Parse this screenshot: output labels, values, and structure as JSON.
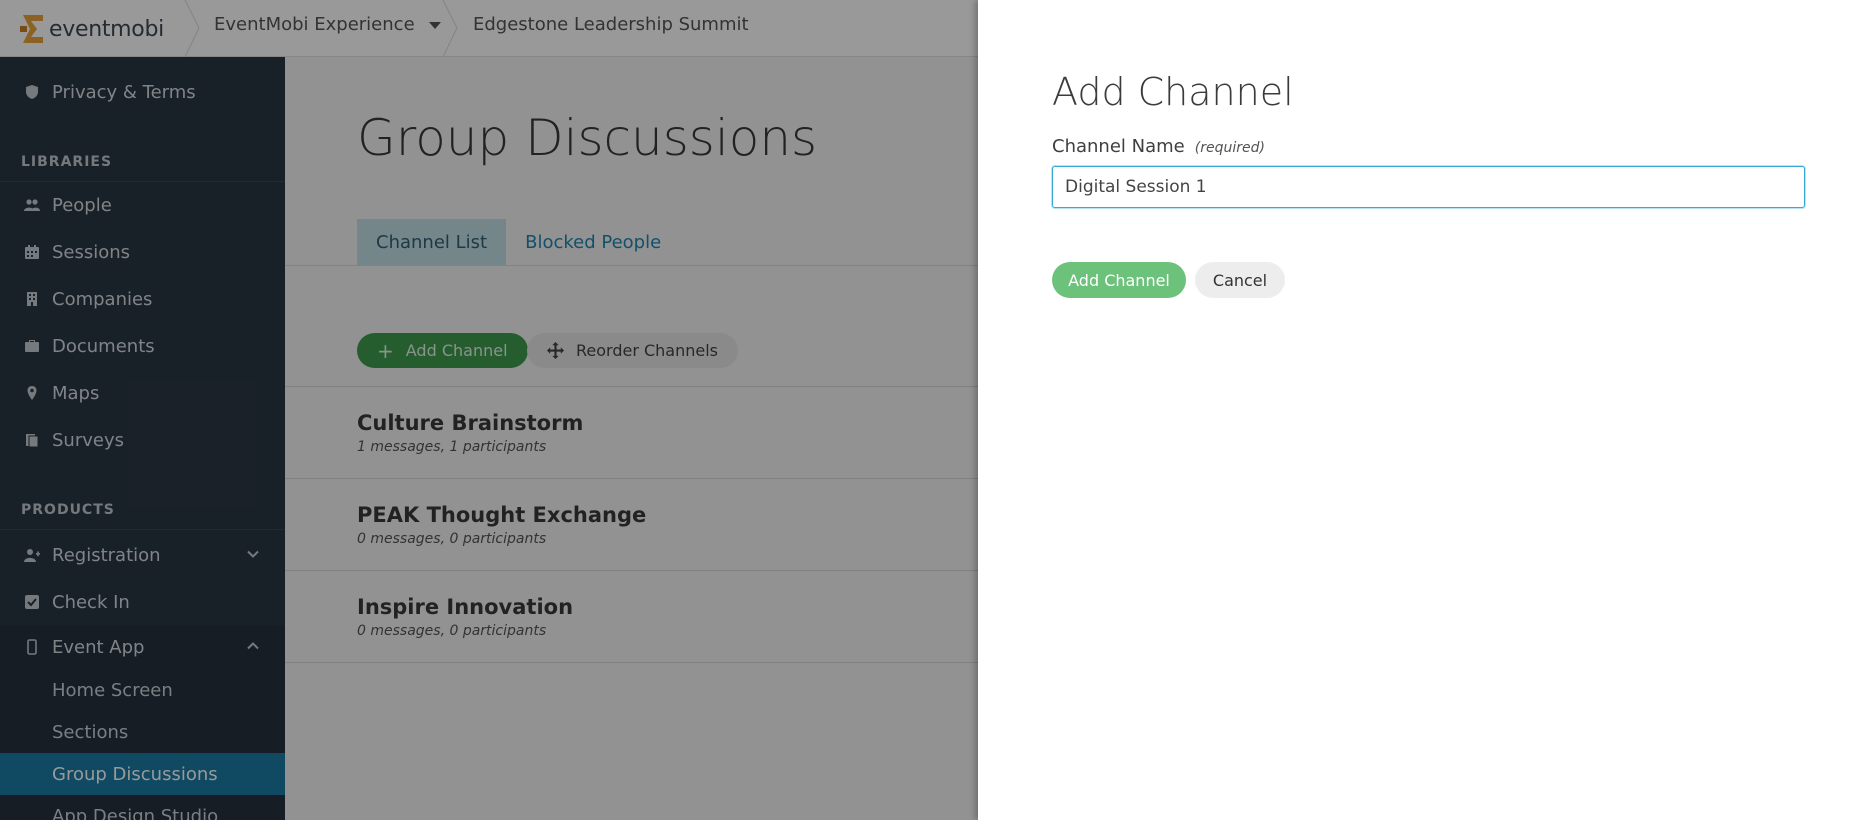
{
  "header": {
    "logo_text": "eventmobi",
    "event_switcher": "EventMobi Experience",
    "event_name": "Edgestone Leadership Summit"
  },
  "sidebar": {
    "top_items": [
      {
        "label": "Privacy & Terms",
        "icon": "shield-icon"
      }
    ],
    "libraries_heading": "LIBRARIES",
    "libraries": [
      {
        "label": "People",
        "icon": "people-icon"
      },
      {
        "label": "Sessions",
        "icon": "calendar-icon"
      },
      {
        "label": "Companies",
        "icon": "building-icon"
      },
      {
        "label": "Documents",
        "icon": "briefcase-icon"
      },
      {
        "label": "Maps",
        "icon": "map-pin-icon"
      },
      {
        "label": "Surveys",
        "icon": "clipboard-icon"
      }
    ],
    "products_heading": "PRODUCTS",
    "products": [
      {
        "label": "Registration",
        "icon": "user-plus-icon",
        "expanded": false
      },
      {
        "label": "Check In",
        "icon": "checkbox-icon"
      },
      {
        "label": "Event App",
        "icon": "mobile-icon",
        "expanded": true
      }
    ],
    "event_app_subitems": [
      {
        "label": "Home Screen",
        "active": false
      },
      {
        "label": "Sections",
        "active": false
      },
      {
        "label": "Group Discussions",
        "active": true
      },
      {
        "label": "App Design Studio",
        "active": false
      }
    ]
  },
  "main": {
    "title": "Group Discussions",
    "tabs": [
      {
        "label": "Channel List",
        "active": true
      },
      {
        "label": "Blocked People",
        "active": false
      }
    ],
    "add_channel_label": "Add Channel",
    "reorder_channels_label": "Reorder Channels",
    "channels": [
      {
        "name": "Culture Brainstorm",
        "meta": "1 messages, 1 participants"
      },
      {
        "name": "PEAK Thought Exchange",
        "meta": "0 messages, 0 participants"
      },
      {
        "name": "Inspire Innovation",
        "meta": "0 messages, 0 participants"
      }
    ]
  },
  "panel": {
    "title": "Add Channel",
    "field_label": "Channel Name",
    "field_required": "(required)",
    "field_value": "Digital Session 1",
    "submit_label": "Add Channel",
    "cancel_label": "Cancel"
  },
  "colors": {
    "sidebar_bg": "#2b3743",
    "active_nav": "#1b7aa3",
    "primary_green": "#3f9b4d",
    "link_blue": "#1f86b1",
    "input_focus": "#36a9d4",
    "logo_orange": "#e8a33d"
  }
}
